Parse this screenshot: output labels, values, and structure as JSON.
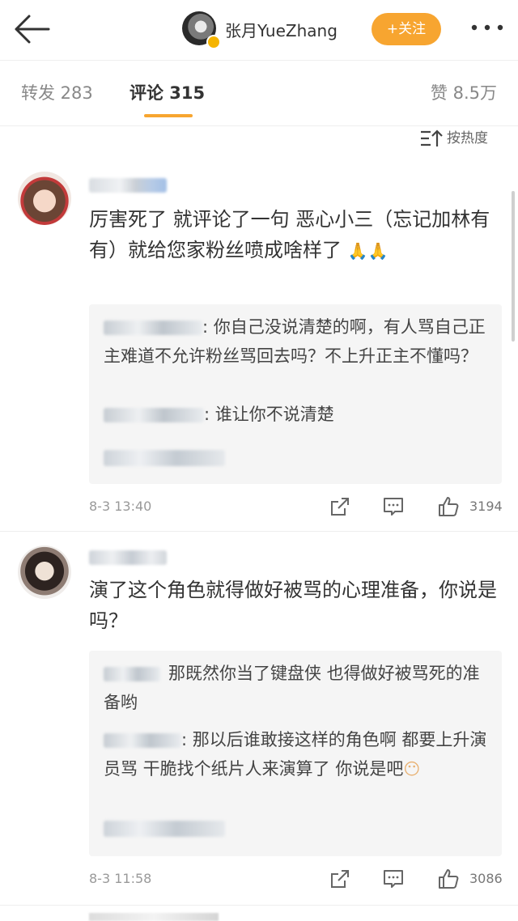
{
  "header": {
    "back_icon": "arrow-left-icon",
    "account_name": "张月YueZhang",
    "follow_label": "+关注",
    "more_icon": "ellipsis-icon",
    "accent_color": "#f7a530"
  },
  "tabs": {
    "repost": "转发 283",
    "comment": "评论 315",
    "like": "赞 8.5万"
  },
  "sort": {
    "label": "按热度",
    "icon": "sort-icon"
  },
  "comments": [
    {
      "text": "厉害死了 就评论了一句 恶心小三（忘记加林有有）就给您家粉丝喷成啥样了",
      "emoji": "🙏",
      "replies": [
        {
          "text": ": 你自己没说清楚的啊，有人骂自己正主难道不允许粉丝骂回去吗？不上升正主不懂吗？"
        },
        {
          "text": ": 谁让你不说清楚"
        }
      ],
      "time": "8-3 13:40",
      "likes": "3194"
    },
    {
      "text": "演了这个角色就得做好被骂的心理准备，你说是吗？",
      "replies": [
        {
          "text": "那既然你当了键盘侠 也得做好被骂死的准备哟"
        },
        {
          "text": ": 那以后谁敢接这样的角色啊 都要上升演员骂 干脆找个纸片人来演算了 你说是吧"
        }
      ],
      "reply_emoji": "😶",
      "time": "8-3 11:58",
      "likes": "3086"
    }
  ]
}
